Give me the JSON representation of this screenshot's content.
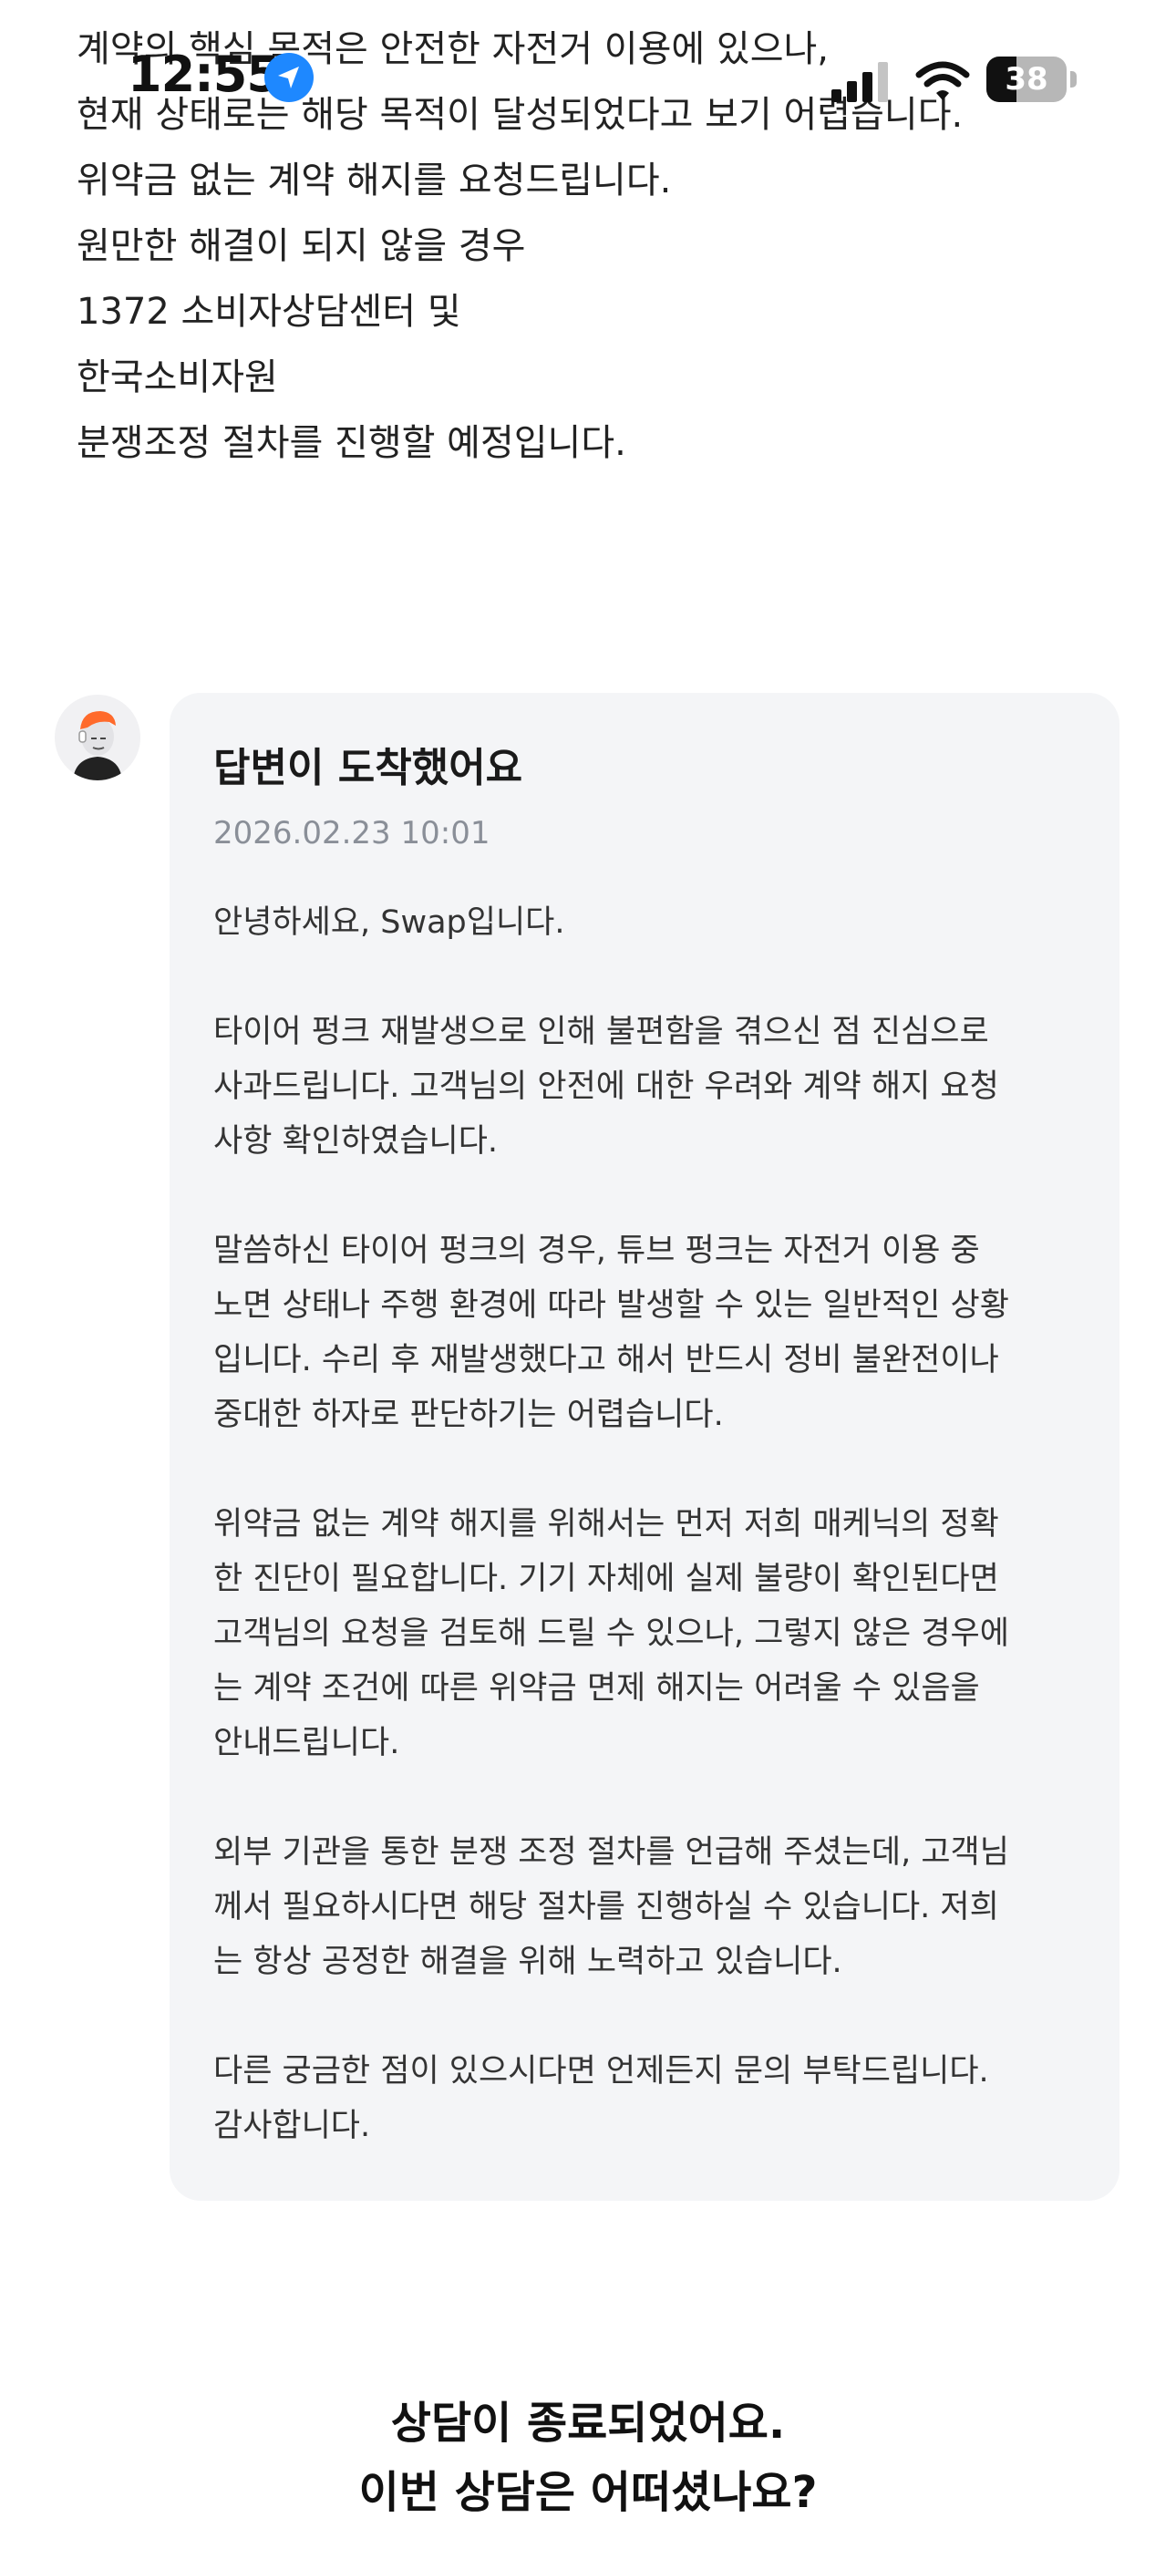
{
  "status_bar": {
    "time": "12:55",
    "battery_level": "38",
    "battery_fraction": 0.38,
    "icons": [
      "location-arrow-icon",
      "cellular-signal-icon",
      "wifi-icon",
      "battery-icon"
    ]
  },
  "user_message": {
    "lines": [
      "계약의 핵심 목적은 안전한 자전거 이용에 있으나,",
      "현재 상태로는 해당 목적이 달성되었다고 보기 어렵습니다.",
      "위약금 없는 계약 해지를 요청드립니다.",
      "원만한 해결이 되지 않을 경우",
      "1372 소비자상담센터 및",
      "한국소비자원",
      "분쟁조정 절차를 진행할 예정입니다."
    ]
  },
  "reply": {
    "title": "답변이 도착했어요",
    "date": "2026.02.23 10:01",
    "paragraphs": [
      [
        "안녕하세요, Swap입니다."
      ],
      [
        "타이어 펑크 재발생으로 인해 불편함을 겪으신 점 진심으로",
        "사과드립니다. 고객님의 안전에 대한 우려와 계약 해지 요청",
        "사항 확인하였습니다."
      ],
      [
        "말씀하신 타이어 펑크의 경우, 튜브 펑크는 자전거 이용 중",
        "노면 상태나 주행 환경에 따라 발생할 수 있는 일반적인 상황",
        "입니다. 수리 후 재발생했다고 해서 반드시 정비 불완전이나",
        "중대한 하자로 판단하기는 어렵습니다."
      ],
      [
        "위약금 없는 계약 해지를 위해서는 먼저 저희 매케닉의 정확",
        "한 진단이 필요합니다. 기기 자체에 실제 불량이 확인된다면",
        "고객님의 요청을 검토해 드릴 수 있으나, 그렇지 않은 경우에",
        "는 계약 조건에 따른 위약금 면제 해지는 어려울 수 있음을",
        "안내드립니다."
      ],
      [
        "외부 기관을 통한 분쟁 조정 절차를 언급해 주셨는데, 고객님",
        "께서 필요하시다면 해당 절차를 진행하실 수 있습니다. 저희",
        "는 항상 공정한 해결을 위해 노력하고 있습니다."
      ],
      [
        "다른 궁금한 점이 있으시다면 언제든지 문의 부탁드립니다.",
        "감사합니다."
      ]
    ]
  },
  "closing": {
    "line1": "상담이 종료되었어요.",
    "line2": "이번 상담은 어떠셨나요?"
  },
  "colors": {
    "card_background": "#f4f5f7",
    "date_text": "#8a8f98",
    "location_blue": "#1e88ff",
    "avatar_orange": "#ff6a2b"
  }
}
